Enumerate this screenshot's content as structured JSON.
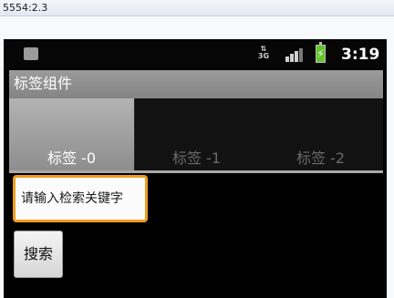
{
  "window": {
    "title": "5554:2.3"
  },
  "status_bar": {
    "network_label": "3G",
    "time": "3:19",
    "icons": [
      "notification-icon",
      "network-3g-icon",
      "signal-icon",
      "battery-charging-icon"
    ]
  },
  "app": {
    "title": "标签组件"
  },
  "tabs": [
    {
      "label": "标签 -0",
      "selected": true
    },
    {
      "label": "标签 -1",
      "selected": false
    },
    {
      "label": "标签 -2",
      "selected": false
    }
  ],
  "search": {
    "placeholder": "请输入检索关键字",
    "value": "",
    "button_label": "搜索"
  },
  "colors": {
    "focus_border": "#ef9d1c",
    "screen_background": "#000000",
    "title_bar": "#8f8f8f",
    "battery": "#62c42b"
  }
}
